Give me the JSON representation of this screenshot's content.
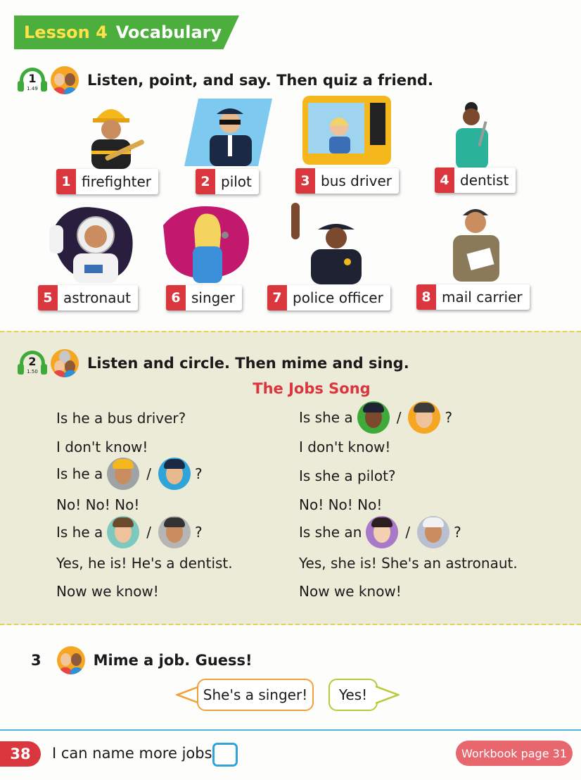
{
  "banner": {
    "lesson": "Lesson 4",
    "title": "Vocabulary"
  },
  "activity1": {
    "track_number": "1",
    "track_code": "1.49",
    "instruction": "Listen, point, and say. Then quiz a friend."
  },
  "vocab": [
    {
      "num": "1",
      "word": "firefighter"
    },
    {
      "num": "2",
      "word": "pilot"
    },
    {
      "num": "3",
      "word": "bus driver"
    },
    {
      "num": "4",
      "word": "dentist"
    },
    {
      "num": "5",
      "word": "astronaut"
    },
    {
      "num": "6",
      "word": "singer"
    },
    {
      "num": "7",
      "word": "police officer"
    },
    {
      "num": "8",
      "word": "mail carrier"
    }
  ],
  "activity2": {
    "track_number": "2",
    "track_code": "1.50",
    "instruction": "Listen and circle. Then mime and sing.",
    "song_title": "The Jobs Song"
  },
  "song": {
    "left": [
      {
        "pre": "Is he a bus driver?",
        "post": ""
      },
      {
        "pre": "I don't know!",
        "post": ""
      },
      {
        "pre": "Is he a",
        "post": "?"
      },
      {
        "pre": "No! No! No!",
        "post": ""
      },
      {
        "pre": "Is he a",
        "post": "?"
      },
      {
        "pre": "Yes, he is!  He's a dentist.",
        "post": ""
      },
      {
        "pre": "Now we know!",
        "post": ""
      }
    ],
    "right": [
      {
        "pre": "Is she a",
        "post": "?"
      },
      {
        "pre": "I don't know!",
        "post": ""
      },
      {
        "pre": "Is she a pilot?",
        "post": ""
      },
      {
        "pre": "No! No! No!",
        "post": ""
      },
      {
        "pre": "Is she an",
        "post": "?"
      },
      {
        "pre": "Yes, she is!  She's an astronaut.",
        "post": ""
      },
      {
        "pre": "Now we know!",
        "post": ""
      }
    ],
    "slash": "/"
  },
  "activity3": {
    "number": "3",
    "instruction": "Mime a job. Guess!",
    "bubble1": "She's a singer!",
    "bubble2": "Yes!"
  },
  "footer": {
    "page_number": "38",
    "can_do": "I can name more jobs.",
    "workbook": "Workbook page 31"
  },
  "colors": {
    "banner_green": "#4caf3d",
    "accent_red": "#d9363e",
    "panel": "#ecebd8",
    "link_blue": "#2fa4d8"
  }
}
